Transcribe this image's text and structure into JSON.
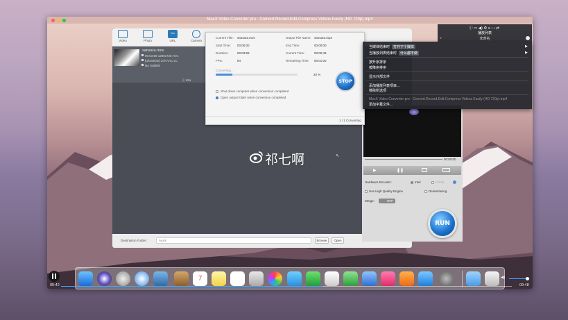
{
  "outer_window": {
    "title": "MacX Video Converter pro - Convert.Record.Edit.Compress Videos Easily (HD 720p).mp4"
  },
  "toolbar": {
    "buttons": [
      {
        "name": "video",
        "label": "Video"
      },
      {
        "name": "photo",
        "label": "Photo"
      },
      {
        "name": "url",
        "label": "URL"
      },
      {
        "name": "camera",
        "label": "Camera"
      }
    ],
    "youtube_icon_text": "You Tube",
    "check_updates": "Check for Updates"
  },
  "file_item": {
    "name": "sansara.mov",
    "meta": [
      "00:03:58 1280x720 AVC",
      "[Ukrainian] 2ch AAC LC",
      "No Subtitle"
    ],
    "info_button": "Info"
  },
  "progress_dialog": {
    "current_title_key": "Current Title:",
    "current_title": "sansara.mov",
    "output_file_key": "Output File Name:",
    "output_file": "sansara.mp4",
    "start_time_key": "Start Time:",
    "start_time": "00:00:00",
    "end_time_key": "End Time:",
    "end_time": "00:00:00",
    "duration_key": "Duration:",
    "duration": "00:03:58",
    "current_time_key": "Current Time:",
    "current_time": "00:00:49",
    "fps_key": "FPS:",
    "fps": "84",
    "remaining_key": "Remaining Time:",
    "remaining": "00:01:00",
    "status": "Converting...",
    "percent_text": "20 %",
    "percent": 20,
    "shutdown_label": "Shut down computer when conversion completed",
    "open_folder_label": "Open output folder when conversion completed",
    "counter": "1 / 1 Converting",
    "stop_label": "STOP"
  },
  "right_panel": {
    "time_label": "00:00:00",
    "hardware_encoder": "Hardware Encoder:",
    "intel": "Intel",
    "nvidia": "nVidia",
    "high_quality": "Use High Quality Engine",
    "deinterlacing": "Deinterlacing",
    "merge_label": "Merge:",
    "merge_toggle": "OFF",
    "run_label": "RUN"
  },
  "destination": {
    "label": "Destination Folder:",
    "value": "/work",
    "browse": "Browse",
    "open": "Open"
  },
  "playlist": {
    "title": "播放列表",
    "subtitle": "未命名"
  },
  "context_menu": {
    "items": [
      {
        "text": "当媒体结束时",
        "pill": "打开下个媒体",
        "arrow": true
      },
      {
        "text": "当播放列表结束时",
        "pill": "什么都不做",
        "arrow": true
      },
      {
        "text": "按升序排序"
      },
      {
        "text": "按降序排序"
      },
      {
        "text": "显示外部文件"
      },
      {
        "text": "添加播放列表项目..."
      },
      {
        "text": "移除所选项"
      },
      {
        "text": "MacX Video Converter pro - Convert.Record.Edit.Compress Videos Easily (HD 720p).mp4",
        "dim": true
      },
      {
        "text": "添加字幕文件..."
      }
    ]
  },
  "watermark": "祁七啊",
  "player": {
    "elapsed": "05:42",
    "total": "09:48",
    "progress": 0.58
  },
  "colors": {
    "accent": "#2d7ab8",
    "run_blue": "#1e76d1",
    "seek_blue": "#3ea6ff"
  }
}
